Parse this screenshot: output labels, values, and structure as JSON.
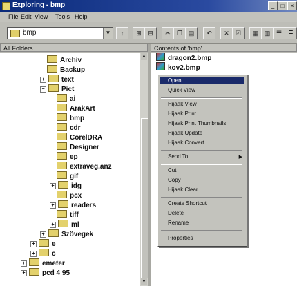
{
  "window": {
    "title": "Exploring - bmp"
  },
  "menu": [
    "File",
    "Edit",
    "View",
    "Tools",
    "Help"
  ],
  "toolbar": {
    "address_value": "bmp"
  },
  "panes": {
    "left_header": "All Folders",
    "right_header": "Contents of 'bmp'"
  },
  "tree": [
    "Archiv",
    "Backup",
    "text",
    "Pict",
    "ai",
    "ArakArt",
    "bmp",
    "cdr",
    "CorelDRA",
    "Designer",
    "ep",
    "extraveg.anz",
    "gif",
    "idg",
    "pcx",
    "readers",
    "tiff",
    "ml",
    "Szövegek",
    "e",
    "c",
    "emeter",
    "pcd 4 95"
  ],
  "files": [
    "dragon2.bmp",
    "kov2.bmp"
  ],
  "context_menu": {
    "items": [
      "Open",
      "Quick View",
      "Hijaak View",
      "Hijaak Print",
      "Hijaak Print Thumbnails",
      "Hijaak Update",
      "Hijaak Convert",
      "Send To",
      "Cut",
      "Copy",
      "Hijaak Clear",
      "Create Shortcut",
      "Delete",
      "Rename",
      "Properties"
    ],
    "submenu_arrow": "▶"
  }
}
